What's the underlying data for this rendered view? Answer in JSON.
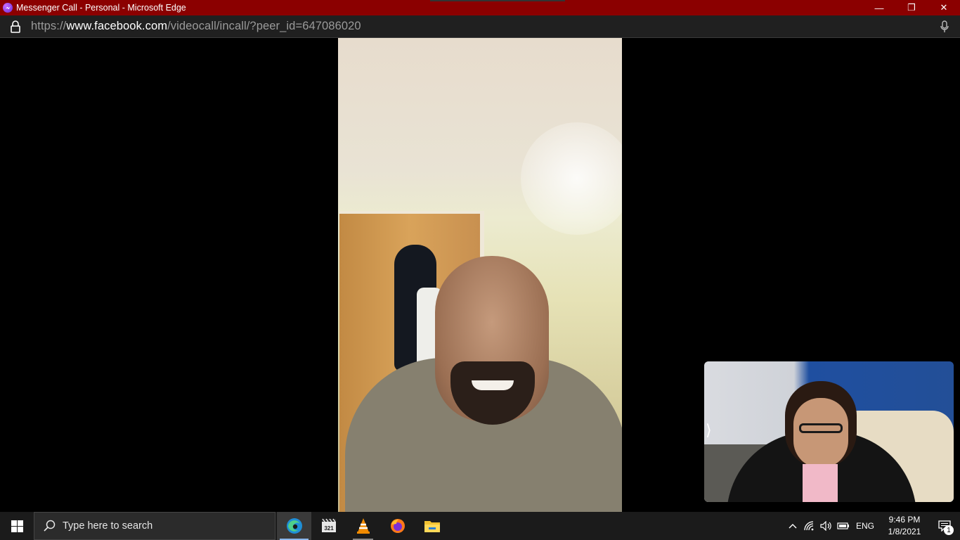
{
  "window": {
    "title": "Messenger Call - Personal - Microsoft Edge",
    "minimize_glyph": "—",
    "restore_glyph": "❐",
    "close_glyph": "✕",
    "titlebar_color": "#8b0000"
  },
  "address_bar": {
    "scheme": "https://",
    "host": "www.facebook.com",
    "path": "/videocall/incall/?peer_id=647086020",
    "lock_icon": "lock-icon",
    "mic_icon": "microphone-icon"
  },
  "call": {
    "remote_video": "remote-participant-video",
    "self_video": "self-view-video",
    "self_view_arrow": "⟩"
  },
  "taskbar": {
    "search_placeholder": "Type here to search",
    "pinned_apps": [
      {
        "name": "edge-icon",
        "state": "active"
      },
      {
        "name": "media-player-321-icon",
        "state": "pinned"
      },
      {
        "name": "vlc-icon",
        "state": "running"
      },
      {
        "name": "firefox-icon",
        "state": "pinned"
      },
      {
        "name": "file-explorer-icon",
        "state": "pinned"
      }
    ],
    "tray": {
      "chevron_glyph": "^",
      "language": "ENG",
      "time": "9:46 PM",
      "date": "1/8/2021",
      "notification_count": "1"
    }
  }
}
